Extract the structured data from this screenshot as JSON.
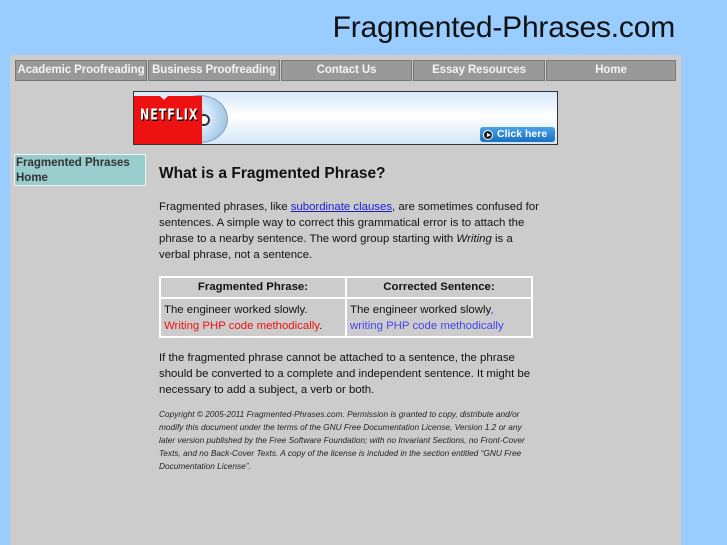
{
  "header": {
    "site_title": "Fragmented-Phrases.com"
  },
  "nav": {
    "items": [
      {
        "label": "Academic Proofreading"
      },
      {
        "label": "Business Proofreading"
      },
      {
        "label": "Contact Us"
      },
      {
        "label": "Essay Resources"
      },
      {
        "label": "Home"
      }
    ]
  },
  "banner": {
    "brand": "NETFLIX",
    "cta_label": "Click here",
    "colors": {
      "brand_red": "#ee1111",
      "cta_blue": "#1a6fc2"
    }
  },
  "sidebar": {
    "items": [
      {
        "label": "Fragmented Phrases Home"
      }
    ]
  },
  "main": {
    "heading": "What is a Fragmented Phrase?",
    "intro": {
      "before_link": "Fragmented phrases, like ",
      "link_text": "subordinate clauses",
      "after_link": ", are sometimes confused for sentences. A simple way to correct this grammatical error is to attach the phrase to a nearby sentence. The word group starting with ",
      "emphasis": "Writing",
      "end": " is a verbal phrase, not a sentence."
    },
    "table": {
      "headers": [
        "Fragmented Phrase:",
        "Corrected Sentence:"
      ],
      "rows": [
        {
          "fragmented": {
            "plain": "The engineer worked slowly. ",
            "highlight": "Writing PHP code methodically",
            "end": "."
          },
          "corrected": {
            "plain": "The engineer worked slowly",
            "highlight": ", writing PHP code methodically"
          }
        }
      ],
      "colors": {
        "fragment_highlight": "#ee1111",
        "corrected_highlight": "#4444ee"
      }
    },
    "conclusion": "If the fragmented phrase cannot be attached to a sentence, the phrase should be converted to a complete and independent sentence. It might be necessary to add a subject, a verb or both.",
    "copyright": "Copyright © 2005-2011 Fragmented-Phrases.com. Permission is granted to copy, distribute and/or modify this document under the terms of the GNU Free Documentation License, Version 1.2 or any later version published by the Free Software Foundation; with no Invariant Sections, no Front-Cover Texts, and no Back-Cover Texts. A copy of the license is included in the section entitled “GNU Free Documentation License”."
  },
  "theme": {
    "page_background": "#99ccff",
    "container_background": "#cccccc",
    "nav_button_background": "#999999",
    "sidebar_background": "#99cccc",
    "link_color": "#1a1ad6"
  }
}
